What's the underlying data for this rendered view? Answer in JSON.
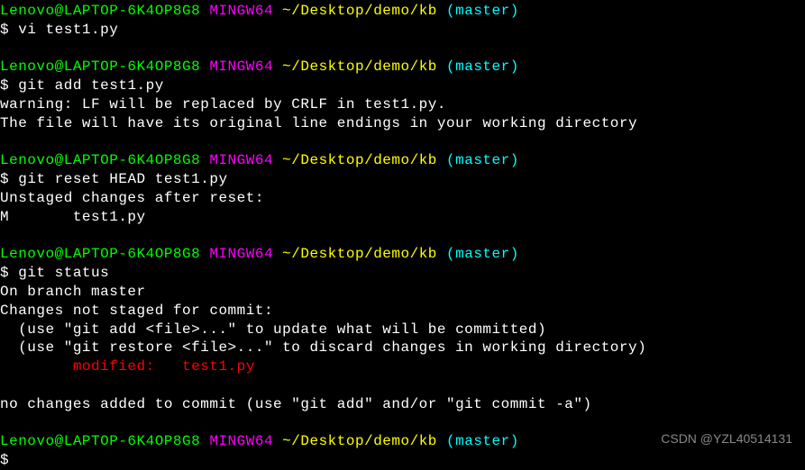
{
  "prompt": {
    "user": "Lenovo@LAPTOP-6K4OP8G8",
    "env": "MINGW64",
    "path": "~/Desktop/demo/kb",
    "branch": "(master)",
    "symbol": "$"
  },
  "block1": {
    "cmd": "vi test1.py"
  },
  "block2": {
    "cmd": "git add test1.py",
    "out1": "warning: LF will be replaced by CRLF in test1.py.",
    "out2": "The file will have its original line endings in your working directory"
  },
  "block3": {
    "cmd": "git reset HEAD test1.py",
    "out1": "Unstaged changes after reset:",
    "out2": "M       test1.py"
  },
  "block4": {
    "cmd": "git status",
    "out1": "On branch master",
    "out2": "Changes not staged for commit:",
    "out3": "  (use \"git add <file>...\" to update what will be committed)",
    "out4": "  (use \"git restore <file>...\" to discard changes in working directory)",
    "out5": "        modified:   test1.py",
    "out6": "no changes added to commit (use \"git add\" and/or \"git commit -a\")"
  },
  "watermark": "CSDN @YZL40514131"
}
